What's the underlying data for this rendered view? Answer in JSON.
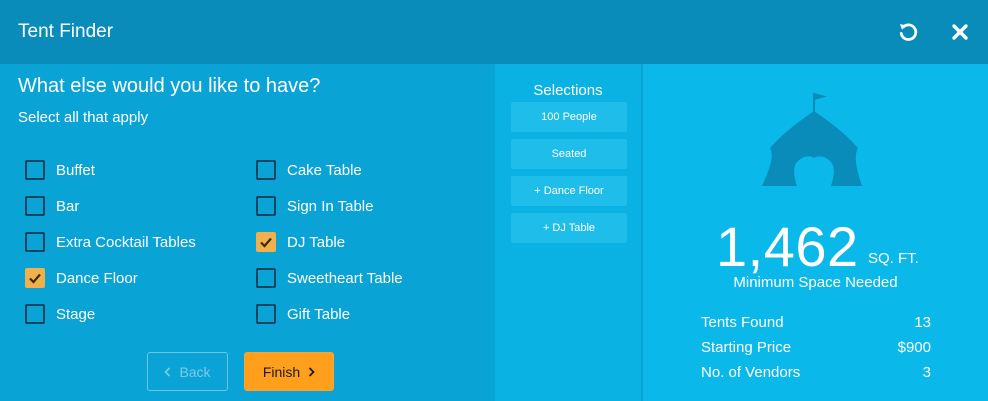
{
  "header": {
    "title": "Tent Finder"
  },
  "question": {
    "title": "What else would you like to have?",
    "subtitle": "Select all that apply"
  },
  "options": [
    {
      "label": "Buffet",
      "checked": false
    },
    {
      "label": "Bar",
      "checked": false
    },
    {
      "label": "Extra Cocktail Tables",
      "checked": false
    },
    {
      "label": "Dance Floor",
      "checked": true
    },
    {
      "label": "Stage",
      "checked": false
    },
    {
      "label": "Cake Table",
      "checked": false
    },
    {
      "label": "Sign In Table",
      "checked": false
    },
    {
      "label": "DJ Table",
      "checked": true
    },
    {
      "label": "Sweetheart Table",
      "checked": false
    },
    {
      "label": "Gift Table",
      "checked": false
    }
  ],
  "buttons": {
    "back": "Back",
    "finish": "Finish"
  },
  "selections": {
    "title": "Selections",
    "items": [
      "100 People",
      "Seated",
      "+ Dance Floor",
      "+ DJ Table"
    ]
  },
  "summary": {
    "area": "1,462",
    "unit": "SQ. FT.",
    "area_label": "Minimum Space Needed",
    "stats": [
      {
        "label": "Tents Found",
        "value": "13"
      },
      {
        "label": "Starting Price",
        "value": "$900"
      },
      {
        "label": "No. of Vendors",
        "value": "3"
      }
    ]
  },
  "icons": {
    "reset": "reset-icon",
    "close": "close-icon",
    "check": "checkmark-icon",
    "tent": "tent-icon",
    "chevron_left": "chevron-left-icon",
    "chevron_right": "chevron-right-icon"
  },
  "colors": {
    "accent_orange": "#ff9f1c",
    "checked_box": "#f0b14c",
    "tent_icon": "#0a8cbb"
  }
}
